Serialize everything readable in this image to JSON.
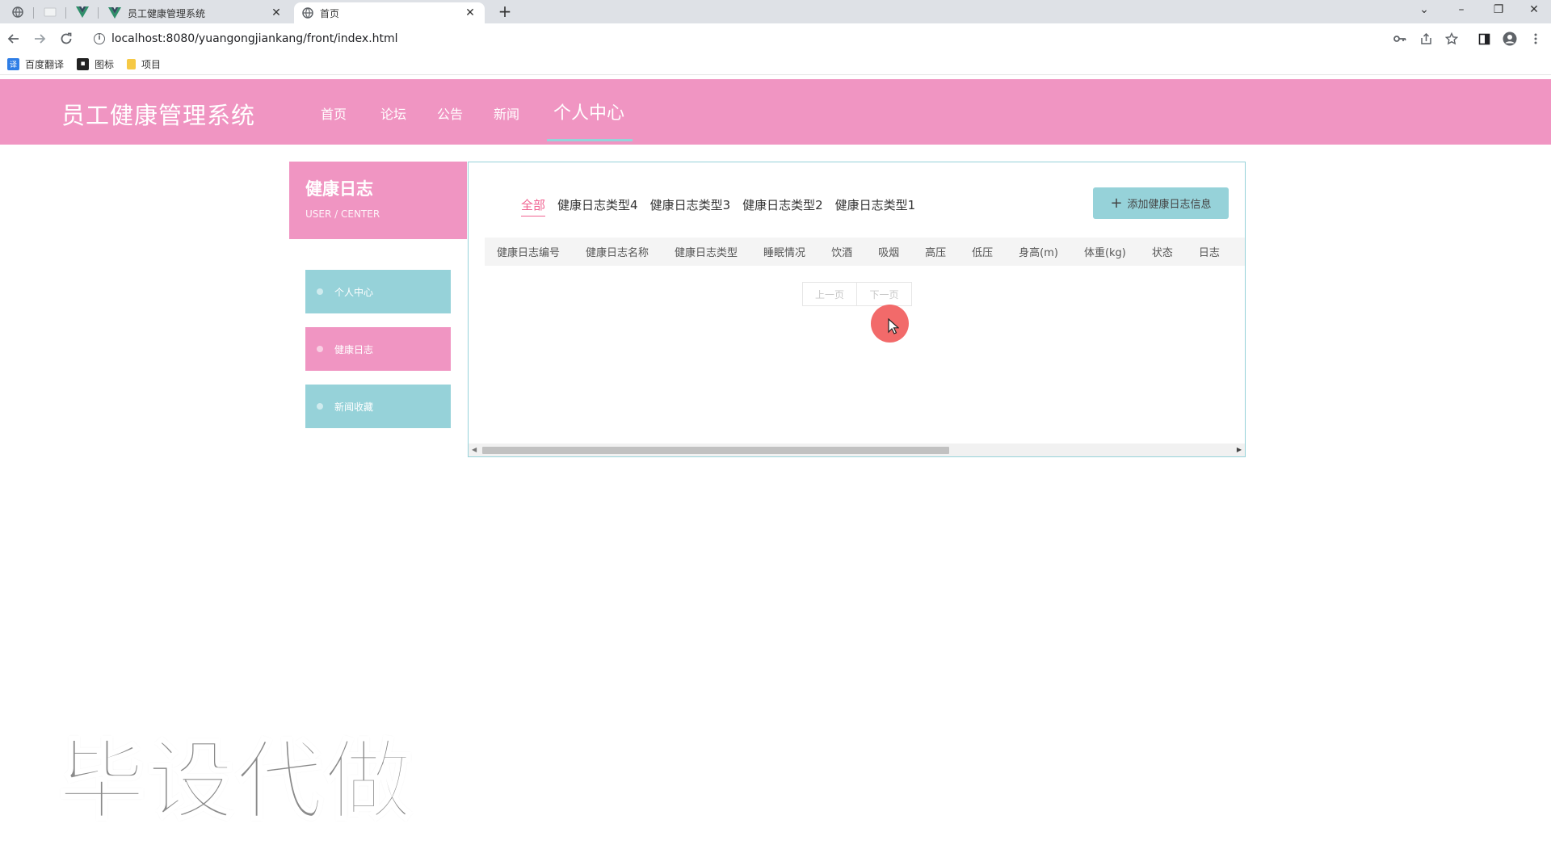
{
  "browser": {
    "tabs": [
      {
        "title": "员工健康管理系统",
        "close": "✕"
      },
      {
        "title": "首页",
        "close": "✕"
      }
    ],
    "new_tab": "+",
    "window": {
      "minimize": "–",
      "restore": "❐",
      "close": "✕",
      "dropdown": "⌄"
    },
    "url": "localhost:8080/yuangongjiankang/front/index.html",
    "bookmarks": [
      {
        "label": "百度翻译",
        "icon_text": "译",
        "color": "#2f7ee6"
      },
      {
        "label": "图标",
        "icon_text": "▪",
        "color": "#222222"
      },
      {
        "label": "项目",
        "icon_text": "",
        "color": "#f6c945"
      }
    ]
  },
  "header": {
    "site_title": "员工健康管理系统",
    "nav": [
      "首页",
      "论坛",
      "公告",
      "新闻",
      "个人中心"
    ],
    "active_nav": "个人中心",
    "bg_color": "#f095c2"
  },
  "sidebar": {
    "title": "健康日志",
    "subtitle": "USER / CENTER",
    "items": [
      {
        "label": "个人中心",
        "active": false
      },
      {
        "label": "健康日志",
        "active": true
      },
      {
        "label": "新闻收藏",
        "active": false
      }
    ],
    "colors": {
      "teal": "#96d2d9",
      "pink": "#f095c2"
    }
  },
  "main": {
    "filters": [
      "全部",
      "健康日志类型4",
      "健康日志类型3",
      "健康日志类型2",
      "健康日志类型1"
    ],
    "active_filter": "全部",
    "add_button": "添加健康日志信息",
    "columns": [
      "健康日志编号",
      "健康日志名称",
      "健康日志类型",
      "睡眠情况",
      "饮酒",
      "吸烟",
      "高压",
      "低压",
      "身高(m)",
      "体重(kg)",
      "状态",
      "日志"
    ],
    "pager": {
      "prev": "上一页",
      "next": "下一页"
    }
  },
  "watermark": "毕设代做"
}
